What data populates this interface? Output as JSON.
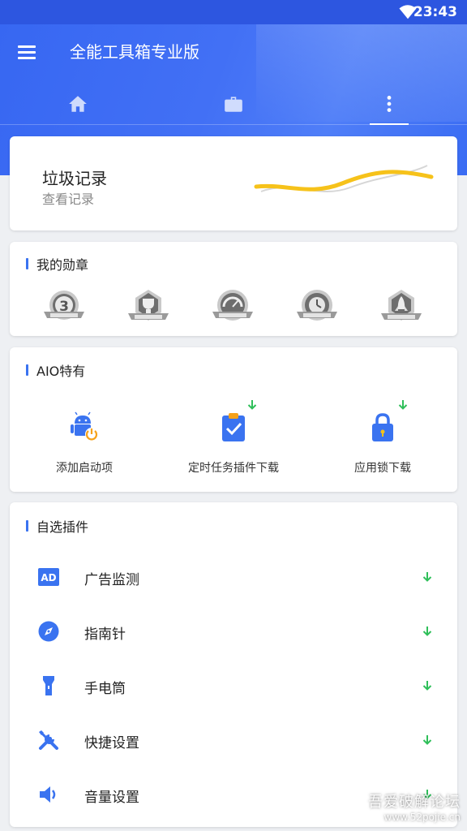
{
  "status_bar": {
    "time": "23:43"
  },
  "app": {
    "title": "全能工具箱专业版"
  },
  "tabs": [
    {
      "icon": "home-icon"
    },
    {
      "icon": "briefcase-icon"
    },
    {
      "icon": "more-vertical-icon",
      "active": true
    }
  ],
  "junk_card": {
    "title": "垃圾记录",
    "subtitle": "查看记录"
  },
  "medals_section": {
    "title": "我的勋章",
    "medals": [
      "3",
      "",
      "",
      "",
      ""
    ]
  },
  "aio_section": {
    "title": "AIO特有",
    "items": [
      {
        "label": "添加启动项",
        "icon": "android-power-icon",
        "downloadable": false
      },
      {
        "label": "定时任务插件下载",
        "icon": "clipboard-check-icon",
        "downloadable": true
      },
      {
        "label": "应用锁下载",
        "icon": "lock-icon",
        "downloadable": true
      }
    ]
  },
  "plugins_section": {
    "title": "自选插件",
    "items": [
      {
        "label": "广告监测",
        "icon": "ad-icon",
        "badge": "AD"
      },
      {
        "label": "指南针",
        "icon": "compass-icon"
      },
      {
        "label": "手电筒",
        "icon": "flashlight-icon"
      },
      {
        "label": "快捷设置",
        "icon": "tools-icon"
      },
      {
        "label": "音量设置",
        "icon": "volume-icon"
      }
    ]
  },
  "watermark": {
    "line1": "吾爱破解论坛",
    "line2": "www.52pojie.cn"
  },
  "colors": {
    "primary": "#3a6cf3",
    "download_green": "#2fbf5a",
    "wave_yellow": "#f6c21a"
  }
}
